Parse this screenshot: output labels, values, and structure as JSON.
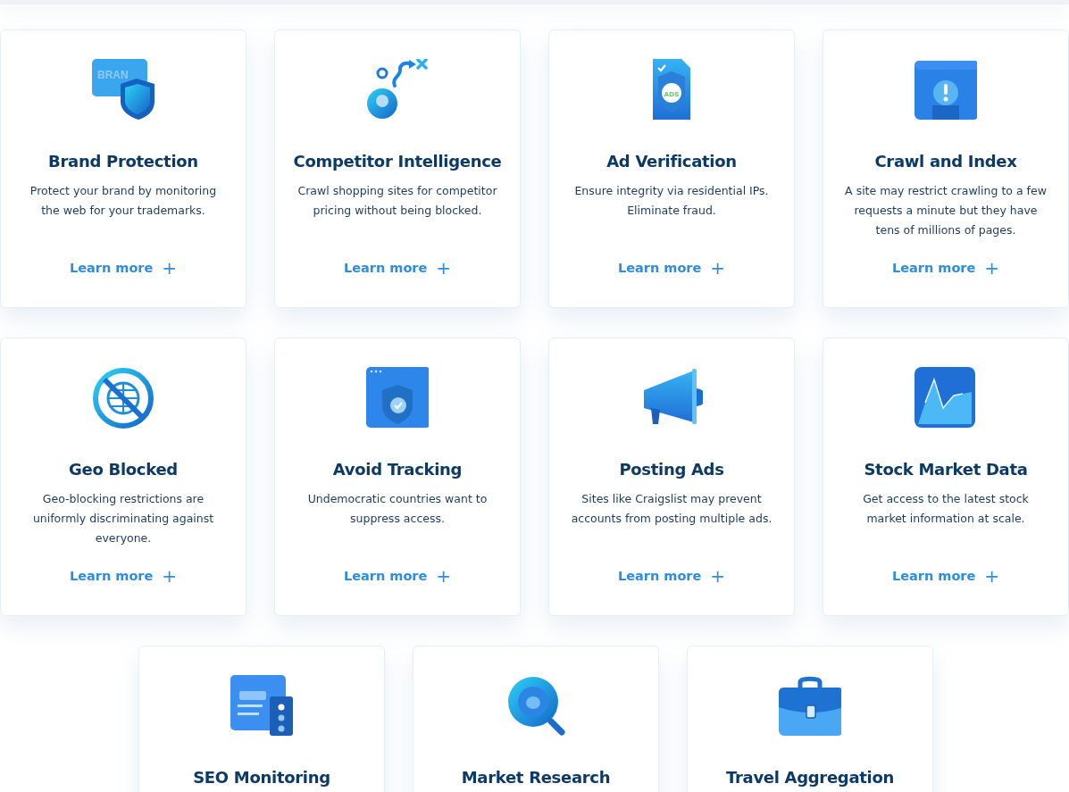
{
  "rows": [
    {
      "cards": [
        {
          "icon_text": "BRAN",
          "title": "Brand Protection",
          "description": "Protect your brand by monitoring the web for your trademarks.",
          "link": "Learn more",
          "link_icon": "+"
        },
        {
          "title": "Competitor Intelligence",
          "description": "Crawl shopping sites for competitor pricing without being blocked.",
          "link": "Learn more",
          "link_icon": "+"
        },
        {
          "icon_text": "ADS",
          "title": "Ad Verification",
          "description": "Ensure integrity via residential IPs. Eliminate fraud.",
          "link": "Learn more",
          "link_icon": "+"
        },
        {
          "title": "Crawl and Index",
          "description": "A site may restrict crawling to a few requests a minute but they have tens of millions of pages.",
          "link": "Learn more",
          "link_icon": "+"
        }
      ]
    },
    {
      "cards": [
        {
          "title": "Geo Blocked",
          "description": "Geo-blocking restrictions are uniformly discriminating against everyone.",
          "link": "Learn more",
          "link_icon": "+"
        },
        {
          "title": "Avoid Tracking",
          "description": "Undemocratic countries want to suppress access.",
          "link": "Learn more",
          "link_icon": "+"
        },
        {
          "title": "Posting Ads",
          "description": "Sites like Craigslist may prevent accounts from posting multiple ads.",
          "link": "Learn more",
          "link_icon": "+"
        },
        {
          "title": "Stock Market Data",
          "description": "Get access to the latest stock market information at scale.",
          "link": "Learn more",
          "link_icon": "+"
        }
      ]
    },
    {
      "cards": [
        {
          "title": "SEO Monitoring"
        },
        {
          "title": "Market Research"
        },
        {
          "title": "Travel Aggregation"
        }
      ]
    }
  ]
}
